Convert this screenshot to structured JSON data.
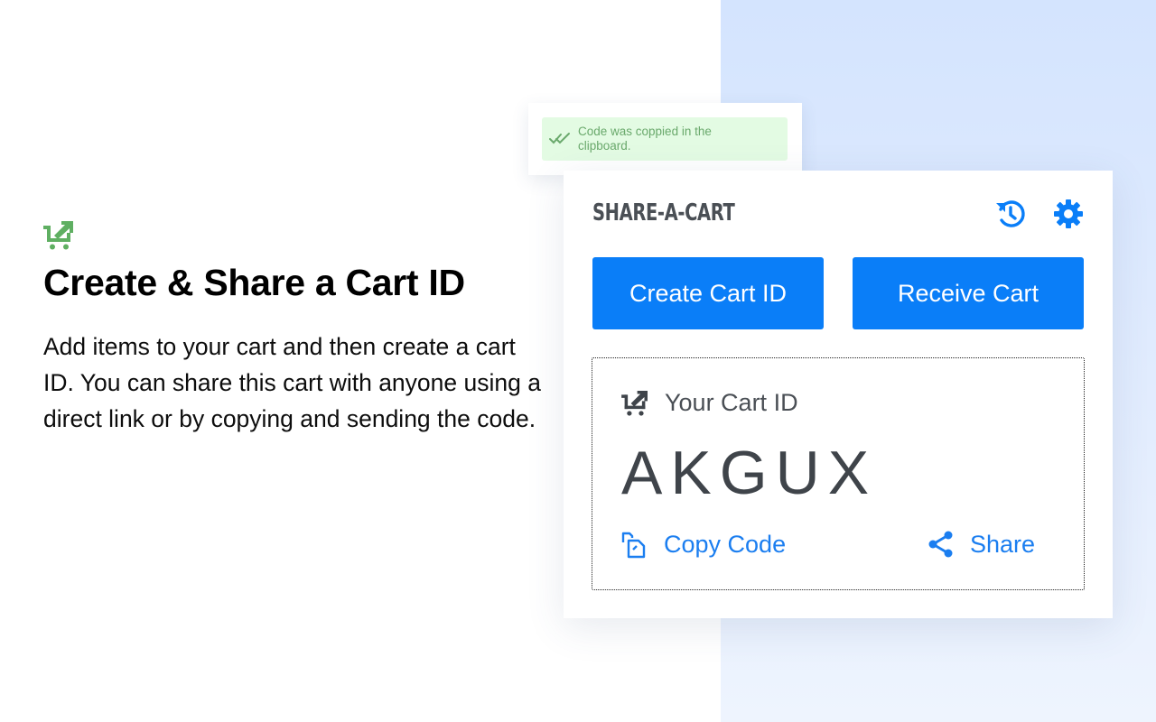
{
  "colors": {
    "accent": "#0a7ef8",
    "link": "#1b7ef0",
    "brand_green": "#5faf62",
    "toast_bg": "#e3fbe3",
    "toast_text": "#6aa96c",
    "text_dark": "#4a4f55",
    "panel_bg": "#d4e4fe"
  },
  "hero": {
    "icon": "cart-share-icon",
    "title": "Create & Share a Cart ID",
    "description": "Add items to your cart and then create a cart ID. You can share this cart with anyone using a direct link or by copying and sending the code."
  },
  "toast": {
    "icon": "double-check-icon",
    "message": "Code was coppied in the clipboard."
  },
  "popup": {
    "brand": "SHARE-A-CART",
    "header_icons": [
      "history-icon",
      "gear-icon"
    ],
    "create_button": "Create Cart ID",
    "receive_button": "Receive Cart",
    "cart_id": {
      "icon": "cart-share-icon",
      "label": "Your Cart ID",
      "code": "AKGUX"
    },
    "actions": {
      "copy": {
        "icon": "copy-icon",
        "label": "Copy Code"
      },
      "share": {
        "icon": "share-icon",
        "label": "Share"
      }
    }
  }
}
